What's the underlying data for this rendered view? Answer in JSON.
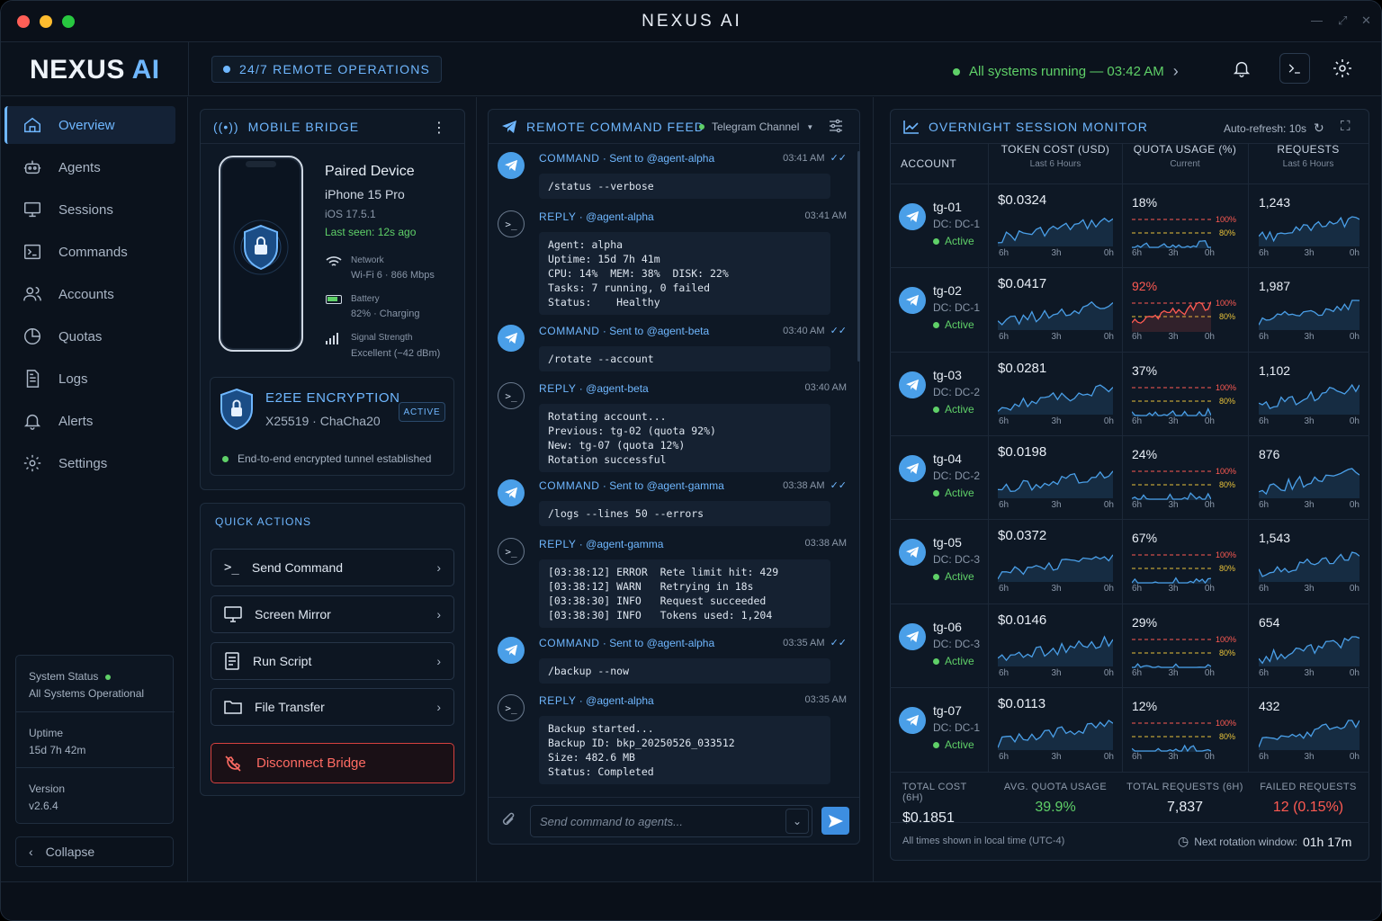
{
  "window": {
    "title": "NEXUS AI"
  },
  "header": {
    "logo_main": "NEXUS",
    "logo_accent": "AI",
    "remote_ops": "24/7 REMOTE OPERATIONS",
    "systems": "All systems running — 03:42 AM"
  },
  "sidebar": {
    "items": [
      {
        "label": "Overview",
        "icon": "home-icon"
      },
      {
        "label": "Agents",
        "icon": "robot-icon"
      },
      {
        "label": "Sessions",
        "icon": "monitor-icon"
      },
      {
        "label": "Commands",
        "icon": "terminal-icon"
      },
      {
        "label": "Accounts",
        "icon": "users-icon"
      },
      {
        "label": "Quotas",
        "icon": "pie-chart-icon"
      },
      {
        "label": "Logs",
        "icon": "document-icon"
      },
      {
        "label": "Alerts",
        "icon": "bell-icon"
      },
      {
        "label": "Settings",
        "icon": "gear-icon"
      }
    ],
    "status_label": "System Status",
    "status_value": "All Systems Operational",
    "uptime_label": "Uptime",
    "uptime_value": "15d 7h 42m",
    "version_label": "Version",
    "version_value": "v2.6.4",
    "collapse": "Collapse"
  },
  "bridge": {
    "title": "MOBILE BRIDGE",
    "device_heading": "Paired Device",
    "model": "iPhone 15 Pro",
    "os": "iOS 17.5.1",
    "last_seen": "Last seen: 12s ago",
    "network_label": "Network",
    "network_value": "Wi-Fi 6 · 866 Mbps",
    "battery_label": "Battery",
    "battery_value": "82% · Charging",
    "signal_label": "Signal Strength",
    "signal_value": "Excellent (−42 dBm)",
    "e2ee_title": "E2EE ENCRYPTION",
    "e2ee_algo": "X25519 · ChaCha20",
    "e2ee_badge": "ACTIVE",
    "e2ee_status": "End-to-end encrypted tunnel established"
  },
  "quick_actions": {
    "title": "QUICK ACTIONS",
    "items": [
      "Send Command",
      "Screen Mirror",
      "Run Script",
      "File Transfer"
    ],
    "disconnect": "Disconnect Bridge"
  },
  "feed": {
    "title": "REMOTE COMMAND FEED",
    "channel": "Telegram Channel",
    "input_placeholder": "Send command to agents...",
    "messages": [
      {
        "kind": "COMMAND",
        "target": "Sent to @agent-alpha",
        "time": "03:41 AM",
        "body": "/status --verbose"
      },
      {
        "kind": "REPLY",
        "target": "@agent-alpha",
        "time": "03:41 AM",
        "body": "Agent: alpha\nUptime: 15d 7h 41m\nCPU: 14%  MEM: 38%  DISK: 22%\nTasks: 7 running, 0 failed\nStatus:    Healthy"
      },
      {
        "kind": "COMMAND",
        "target": "Sent to @agent-beta",
        "time": "03:40 AM",
        "body": "/rotate --account"
      },
      {
        "kind": "REPLY",
        "target": "@agent-beta",
        "time": "03:40 AM",
        "body": "Rotating account...\nPrevious: tg-02 (quota 92%)\nNew: tg-07 (quota 12%)\nRotation successful"
      },
      {
        "kind": "COMMAND",
        "target": "Sent to @agent-gamma",
        "time": "03:38 AM",
        "body": "/logs --lines 50 --errors"
      },
      {
        "kind": "REPLY",
        "target": "@agent-gamma",
        "time": "03:38 AM",
        "body": "[03:38:12] ERROR  Rete limit hit: 429\n[03:38:12] WARN   Retrying in 18s\n[03:38:30] INFO   Request succeeded\n[03:38:30] INFO   Tokens used: 1,204"
      },
      {
        "kind": "COMMAND",
        "target": "Sent to @agent-alpha",
        "time": "03:35 AM",
        "body": "/backup --now"
      },
      {
        "kind": "REPLY",
        "target": "@agent-alpha",
        "time": "03:35 AM",
        "body": "Backup started...\nBackup ID: bkp_20250526_033512\nSize: 482.6 MB\nStatus: Completed"
      }
    ]
  },
  "monitor": {
    "title": "OVERNIGHT SESSION MONITOR",
    "auto_refresh": "Auto-refresh: 10s",
    "col_account": "ACCOUNT",
    "col_cost": "TOKEN COST (USD)",
    "col_cost_sub": "Last 6 Hours",
    "col_quota": "QUOTA USAGE (%)",
    "col_quota_sub": "Current",
    "col_req": "REQUESTS",
    "col_req_sub": "Last 6 Hours",
    "axis": [
      "6h",
      "3h",
      "0h"
    ],
    "th100": "100%",
    "th80": "80%",
    "rows": [
      {
        "id": "tg-01",
        "dc": "DC: DC-1",
        "status": "Active",
        "cost": "$0.0324",
        "quota": "18%",
        "requests": "1,243"
      },
      {
        "id": "tg-02",
        "dc": "DC: DC-1",
        "status": "Active",
        "cost": "$0.0417",
        "quota": "92%",
        "requests": "1,987"
      },
      {
        "id": "tg-03",
        "dc": "DC: DC-2",
        "status": "Active",
        "cost": "$0.0281",
        "quota": "37%",
        "requests": "1,102"
      },
      {
        "id": "tg-04",
        "dc": "DC: DC-2",
        "status": "Active",
        "cost": "$0.0198",
        "quota": "24%",
        "requests": "876"
      },
      {
        "id": "tg-05",
        "dc": "DC: DC-3",
        "status": "Active",
        "cost": "$0.0372",
        "quota": "67%",
        "requests": "1,543"
      },
      {
        "id": "tg-06",
        "dc": "DC: DC-3",
        "status": "Active",
        "cost": "$0.0146",
        "quota": "29%",
        "requests": "654"
      },
      {
        "id": "tg-07",
        "dc": "DC: DC-1",
        "status": "Active",
        "cost": "$0.0113",
        "quota": "12%",
        "requests": "432"
      }
    ],
    "totals": {
      "cost_label": "TOTAL COST (6H)",
      "cost": "$0.1851",
      "quota_label": "AVG. QUOTA USAGE",
      "quota": "39.9%",
      "req_label": "TOTAL REQUESTS (6H)",
      "req": "7,837",
      "fail_label": "FAILED REQUESTS",
      "fail": "12 (0.15%)"
    },
    "tz_note": "All times shown in local time (UTC-4)",
    "rotation_label": "Next rotation window:",
    "rotation_value": "01h 17m"
  },
  "colors": {
    "accent": "#6fb7ff",
    "ok": "#5fd068",
    "danger": "#ff5a52",
    "warn": "#e8c23a",
    "telegram": "#4a9fe8"
  }
}
